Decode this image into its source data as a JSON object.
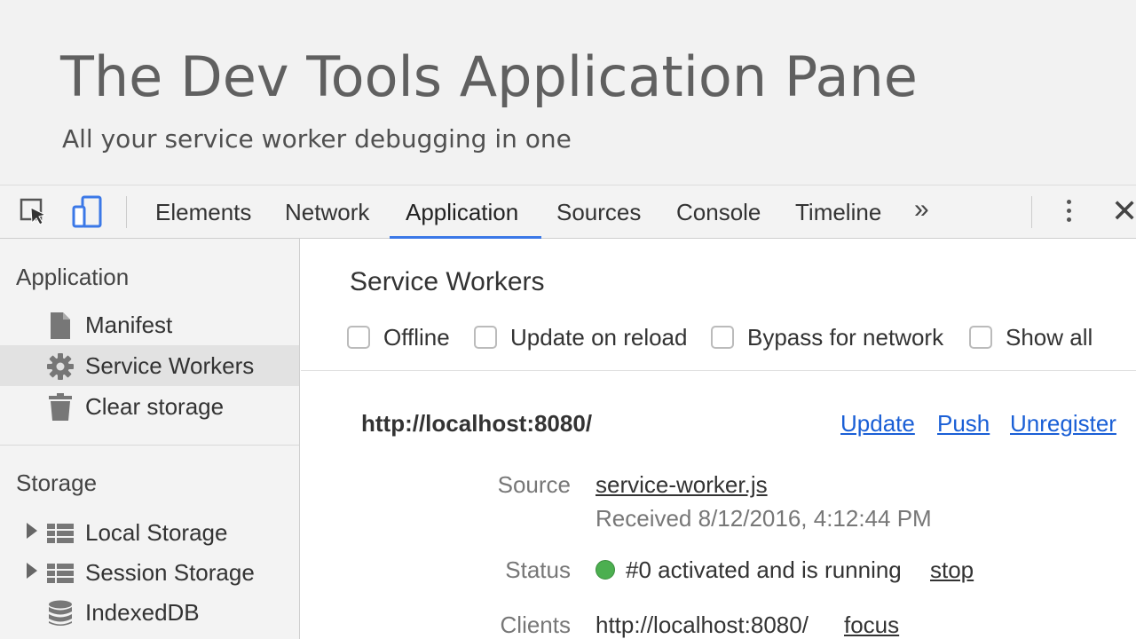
{
  "slide": {
    "title": "The Dev Tools Application Pane",
    "subtitle": "All your service worker debugging in one"
  },
  "toolbar": {
    "icons": [
      "inspect-icon",
      "device-mode-icon"
    ],
    "tabs": [
      {
        "label": "Elements"
      },
      {
        "label": "Network"
      },
      {
        "label": "Application",
        "active": true
      },
      {
        "label": "Sources"
      },
      {
        "label": "Console"
      },
      {
        "label": "Timeline"
      }
    ],
    "more_label": "»",
    "close_label": "✕",
    "accent": "#3b78e7"
  },
  "sidebar": {
    "application_heading": "Application",
    "application_items": [
      {
        "label": "Manifest",
        "icon": "document-icon"
      },
      {
        "label": "Service Workers",
        "icon": "gear-icon",
        "selected": true
      },
      {
        "label": "Clear storage",
        "icon": "trash-icon"
      }
    ],
    "storage_heading": "Storage",
    "storage_items": [
      {
        "label": "Local Storage",
        "icon": "grid-icon",
        "expandable": true
      },
      {
        "label": "Session Storage",
        "icon": "grid-icon",
        "expandable": true
      },
      {
        "label": "IndexedDB",
        "icon": "database-icon"
      }
    ]
  },
  "main": {
    "title": "Service Workers",
    "options": [
      {
        "label": "Offline",
        "checked": false
      },
      {
        "label": "Update on reload",
        "checked": false
      },
      {
        "label": "Bypass for network",
        "checked": false
      },
      {
        "label": "Show all",
        "checked": false
      }
    ],
    "worker": {
      "scope": "http://localhost:8080/",
      "actions": [
        "Update",
        "Push",
        "Unregister"
      ],
      "source_label": "Source",
      "source_link": "service-worker.js",
      "received": "Received 8/12/2016, 4:12:44 PM",
      "status_label": "Status",
      "status_text": "#0 activated and is running",
      "status_action": "stop",
      "status_color": "#4caf50",
      "clients_label": "Clients",
      "client_url": "http://localhost:8080/",
      "client_action": "focus"
    },
    "link_color": "#1a5fd6"
  }
}
